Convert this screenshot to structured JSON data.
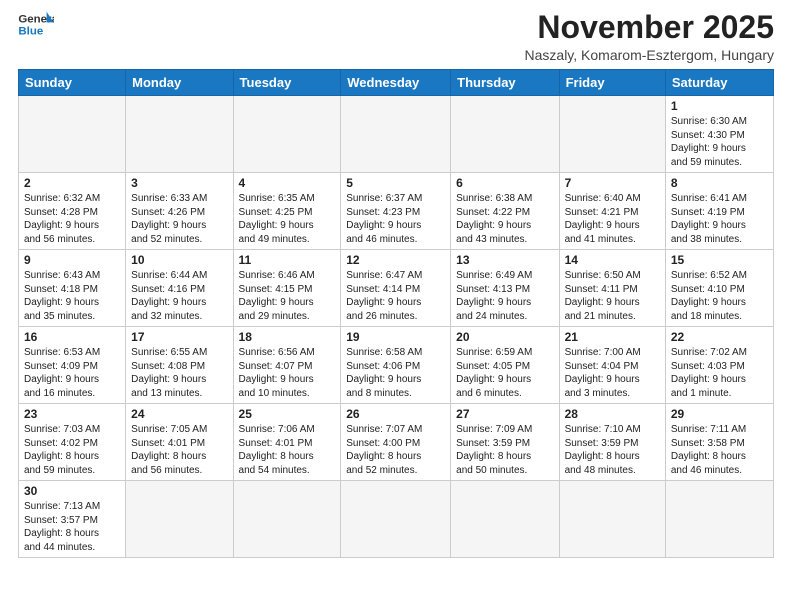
{
  "header": {
    "logo_text_general": "General",
    "logo_text_blue": "Blue",
    "month": "November 2025",
    "location": "Naszaly, Komarom-Esztergom, Hungary"
  },
  "weekdays": [
    "Sunday",
    "Monday",
    "Tuesday",
    "Wednesday",
    "Thursday",
    "Friday",
    "Saturday"
  ],
  "weeks": [
    [
      {
        "day": "",
        "info": ""
      },
      {
        "day": "",
        "info": ""
      },
      {
        "day": "",
        "info": ""
      },
      {
        "day": "",
        "info": ""
      },
      {
        "day": "",
        "info": ""
      },
      {
        "day": "",
        "info": ""
      },
      {
        "day": "1",
        "info": "Sunrise: 6:30 AM\nSunset: 4:30 PM\nDaylight: 9 hours\nand 59 minutes."
      }
    ],
    [
      {
        "day": "2",
        "info": "Sunrise: 6:32 AM\nSunset: 4:28 PM\nDaylight: 9 hours\nand 56 minutes."
      },
      {
        "day": "3",
        "info": "Sunrise: 6:33 AM\nSunset: 4:26 PM\nDaylight: 9 hours\nand 52 minutes."
      },
      {
        "day": "4",
        "info": "Sunrise: 6:35 AM\nSunset: 4:25 PM\nDaylight: 9 hours\nand 49 minutes."
      },
      {
        "day": "5",
        "info": "Sunrise: 6:37 AM\nSunset: 4:23 PM\nDaylight: 9 hours\nand 46 minutes."
      },
      {
        "day": "6",
        "info": "Sunrise: 6:38 AM\nSunset: 4:22 PM\nDaylight: 9 hours\nand 43 minutes."
      },
      {
        "day": "7",
        "info": "Sunrise: 6:40 AM\nSunset: 4:21 PM\nDaylight: 9 hours\nand 41 minutes."
      },
      {
        "day": "8",
        "info": "Sunrise: 6:41 AM\nSunset: 4:19 PM\nDaylight: 9 hours\nand 38 minutes."
      }
    ],
    [
      {
        "day": "9",
        "info": "Sunrise: 6:43 AM\nSunset: 4:18 PM\nDaylight: 9 hours\nand 35 minutes."
      },
      {
        "day": "10",
        "info": "Sunrise: 6:44 AM\nSunset: 4:16 PM\nDaylight: 9 hours\nand 32 minutes."
      },
      {
        "day": "11",
        "info": "Sunrise: 6:46 AM\nSunset: 4:15 PM\nDaylight: 9 hours\nand 29 minutes."
      },
      {
        "day": "12",
        "info": "Sunrise: 6:47 AM\nSunset: 4:14 PM\nDaylight: 9 hours\nand 26 minutes."
      },
      {
        "day": "13",
        "info": "Sunrise: 6:49 AM\nSunset: 4:13 PM\nDaylight: 9 hours\nand 24 minutes."
      },
      {
        "day": "14",
        "info": "Sunrise: 6:50 AM\nSunset: 4:11 PM\nDaylight: 9 hours\nand 21 minutes."
      },
      {
        "day": "15",
        "info": "Sunrise: 6:52 AM\nSunset: 4:10 PM\nDaylight: 9 hours\nand 18 minutes."
      }
    ],
    [
      {
        "day": "16",
        "info": "Sunrise: 6:53 AM\nSunset: 4:09 PM\nDaylight: 9 hours\nand 16 minutes."
      },
      {
        "day": "17",
        "info": "Sunrise: 6:55 AM\nSunset: 4:08 PM\nDaylight: 9 hours\nand 13 minutes."
      },
      {
        "day": "18",
        "info": "Sunrise: 6:56 AM\nSunset: 4:07 PM\nDaylight: 9 hours\nand 10 minutes."
      },
      {
        "day": "19",
        "info": "Sunrise: 6:58 AM\nSunset: 4:06 PM\nDaylight: 9 hours\nand 8 minutes."
      },
      {
        "day": "20",
        "info": "Sunrise: 6:59 AM\nSunset: 4:05 PM\nDaylight: 9 hours\nand 6 minutes."
      },
      {
        "day": "21",
        "info": "Sunrise: 7:00 AM\nSunset: 4:04 PM\nDaylight: 9 hours\nand 3 minutes."
      },
      {
        "day": "22",
        "info": "Sunrise: 7:02 AM\nSunset: 4:03 PM\nDaylight: 9 hours\nand 1 minute."
      }
    ],
    [
      {
        "day": "23",
        "info": "Sunrise: 7:03 AM\nSunset: 4:02 PM\nDaylight: 8 hours\nand 59 minutes."
      },
      {
        "day": "24",
        "info": "Sunrise: 7:05 AM\nSunset: 4:01 PM\nDaylight: 8 hours\nand 56 minutes."
      },
      {
        "day": "25",
        "info": "Sunrise: 7:06 AM\nSunset: 4:01 PM\nDaylight: 8 hours\nand 54 minutes."
      },
      {
        "day": "26",
        "info": "Sunrise: 7:07 AM\nSunset: 4:00 PM\nDaylight: 8 hours\nand 52 minutes."
      },
      {
        "day": "27",
        "info": "Sunrise: 7:09 AM\nSunset: 3:59 PM\nDaylight: 8 hours\nand 50 minutes."
      },
      {
        "day": "28",
        "info": "Sunrise: 7:10 AM\nSunset: 3:59 PM\nDaylight: 8 hours\nand 48 minutes."
      },
      {
        "day": "29",
        "info": "Sunrise: 7:11 AM\nSunset: 3:58 PM\nDaylight: 8 hours\nand 46 minutes."
      }
    ],
    [
      {
        "day": "30",
        "info": "Sunrise: 7:13 AM\nSunset: 3:57 PM\nDaylight: 8 hours\nand 44 minutes."
      },
      {
        "day": "",
        "info": ""
      },
      {
        "day": "",
        "info": ""
      },
      {
        "day": "",
        "info": ""
      },
      {
        "day": "",
        "info": ""
      },
      {
        "day": "",
        "info": ""
      },
      {
        "day": "",
        "info": ""
      }
    ]
  ]
}
